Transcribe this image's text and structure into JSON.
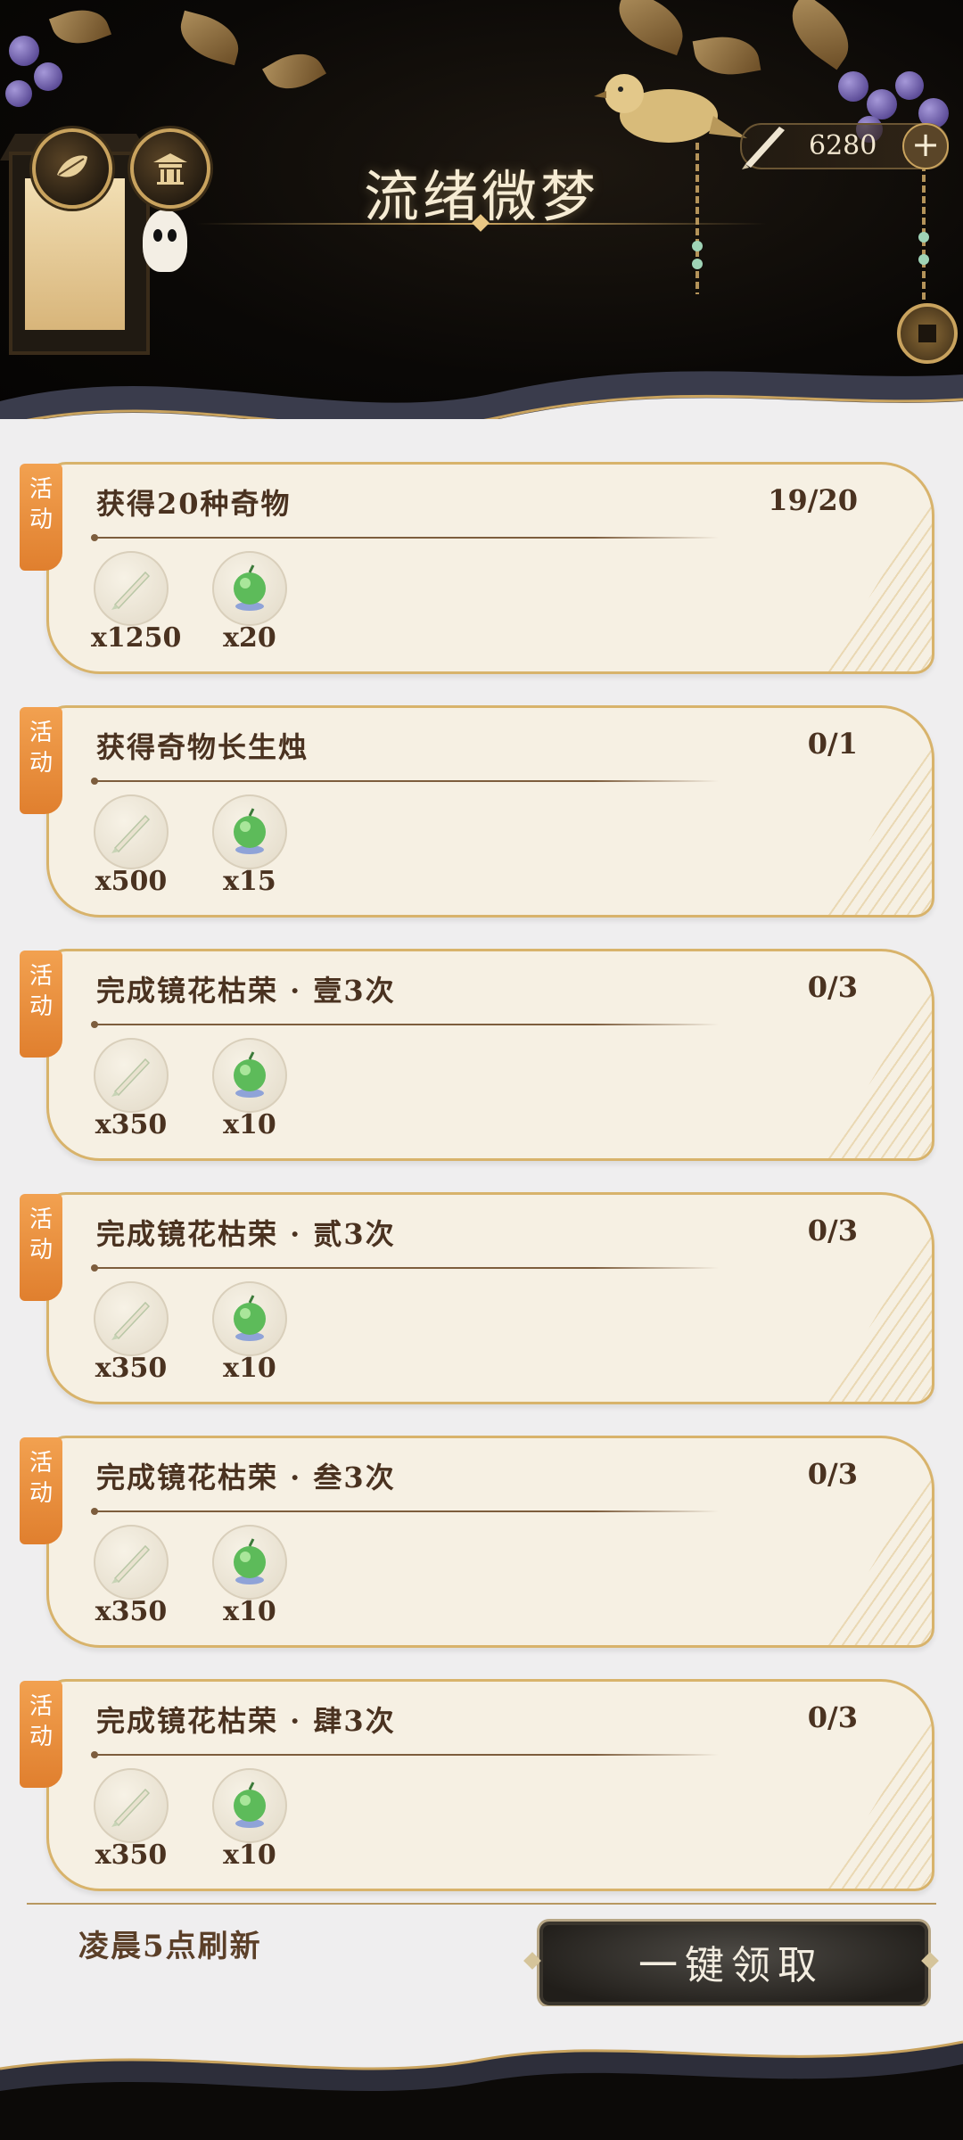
{
  "header": {
    "title": "流绪微梦",
    "currency_value": "6280",
    "plus_label": "+"
  },
  "tasks": [
    {
      "badge": [
        "活",
        "动"
      ],
      "name": "获得20种奇物",
      "progress": "19/20",
      "rewards": [
        {
          "icon": "brush-icon",
          "qty": "x1250"
        },
        {
          "icon": "jade-orb-icon",
          "qty": "x20"
        }
      ]
    },
    {
      "badge": [
        "活",
        "动"
      ],
      "name": "获得奇物长生烛",
      "progress": "0/1",
      "rewards": [
        {
          "icon": "brush-icon",
          "qty": "x500"
        },
        {
          "icon": "jade-orb-icon",
          "qty": "x15"
        }
      ]
    },
    {
      "badge": [
        "活",
        "动"
      ],
      "name": "完成镜花枯荣 · 壹3次",
      "progress": "0/3",
      "rewards": [
        {
          "icon": "brush-icon",
          "qty": "x350"
        },
        {
          "icon": "jade-orb-icon",
          "qty": "x10"
        }
      ]
    },
    {
      "badge": [
        "活",
        "动"
      ],
      "name": "完成镜花枯荣 · 贰3次",
      "progress": "0/3",
      "rewards": [
        {
          "icon": "brush-icon",
          "qty": "x350"
        },
        {
          "icon": "jade-orb-icon",
          "qty": "x10"
        }
      ]
    },
    {
      "badge": [
        "活",
        "动"
      ],
      "name": "完成镜花枯荣 · 叁3次",
      "progress": "0/3",
      "rewards": [
        {
          "icon": "brush-icon",
          "qty": "x350"
        },
        {
          "icon": "jade-orb-icon",
          "qty": "x10"
        }
      ]
    },
    {
      "badge": [
        "活",
        "动"
      ],
      "name": "完成镜花枯荣 · 肆3次",
      "progress": "0/3",
      "rewards": [
        {
          "icon": "brush-icon",
          "qty": "x350"
        },
        {
          "icon": "jade-orb-icon",
          "qty": "x10"
        }
      ]
    }
  ],
  "footer": {
    "refresh_text": "凌晨5点刷新",
    "claim_all_label": "一键领取"
  }
}
